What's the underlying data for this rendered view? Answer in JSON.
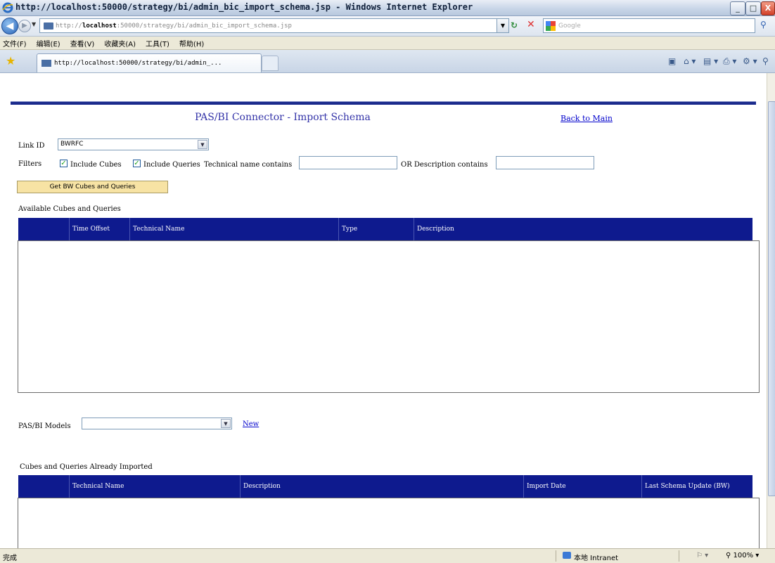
{
  "window": {
    "title": "http://localhost:50000/strategy/bi/admin_bic_import_schema.jsp - Windows Internet Explorer",
    "minimize": "_",
    "maximize": "□",
    "close": "X"
  },
  "navbar": {
    "back": "◀",
    "forward": "▶",
    "address_prefix": "http://",
    "address_host": "localhost",
    "address_rest": ":50000/strategy/bi/admin_bic_import_schema.jsp",
    "search_placeholder": "Google"
  },
  "menu": [
    "文件(F)",
    "编辑(E)",
    "查看(V)",
    "收藏夹(A)",
    "工具(T)",
    "帮助(H)"
  ],
  "tab": {
    "title": "http://localhost:50000/strategy/bi/admin_..."
  },
  "page": {
    "title": "PAS/BI Connector - Import Schema",
    "back_link": "Back to Main",
    "link_id_label": "Link ID",
    "link_id_value": "BWRFC",
    "filters_label": "Filters",
    "include_cubes_label": "Include Cubes",
    "include_cubes_checked": true,
    "include_queries_label": "Include Queries",
    "include_queries_checked": true,
    "tech_name_label": "Technical name contains",
    "tech_name_value": "",
    "or_desc_label": "OR  Description contains",
    "desc_value": "",
    "get_button": "Get BW Cubes and Queries",
    "available_label": "Available Cubes and Queries",
    "available_columns": [
      "Time Offset",
      "Technical Name",
      "Type",
      "Description"
    ],
    "models_label": "PAS/BI Models",
    "models_value": "",
    "new_link": "New",
    "imported_label": "Cubes and Queries Already Imported",
    "imported_columns": [
      "Technical Name",
      "Description",
      "Import Date",
      "Last Schema Update (BW)"
    ]
  },
  "status": {
    "text": "完成",
    "zone": "本地 Intranet",
    "zoom": "100%"
  },
  "colors": {
    "grid_header": "#0e1a8e",
    "title_blue": "#3333a8",
    "button_bg": "#f7e3a4",
    "link": "#0000cc"
  }
}
